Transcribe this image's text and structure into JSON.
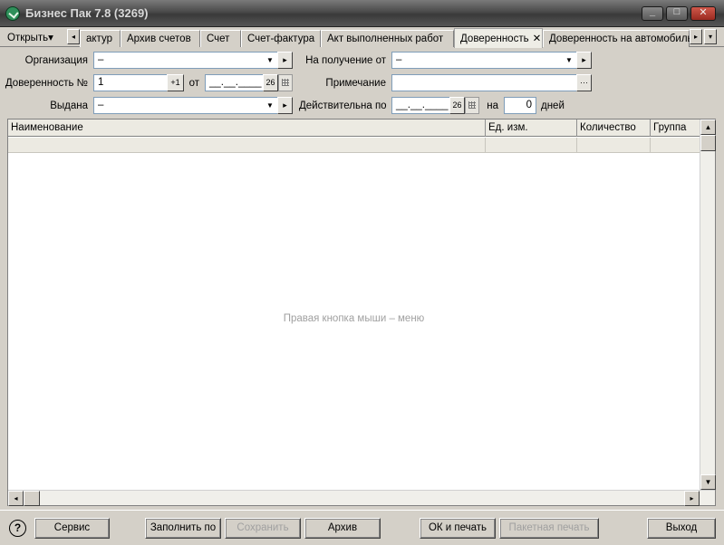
{
  "window": {
    "title": "Бизнес Пак 7.8 (3269)",
    "min_glyph": "_",
    "max_glyph": "□",
    "close_glyph": "✕"
  },
  "tabbar": {
    "open_menu": "Открыть",
    "open_menu_arrow": "▾",
    "prev_arrow": "◂",
    "next_arrow": "▸",
    "overflow_arrow": "▾",
    "tabs": [
      {
        "label": "актур"
      },
      {
        "label": "Архив счетов"
      },
      {
        "label": "Счет"
      },
      {
        "label": "Счет-фактура"
      },
      {
        "label": "Акт выполненных работ"
      },
      {
        "label": "Доверенность",
        "active": true
      },
      {
        "label": "Доверенность на автомобиль"
      }
    ],
    "close_glyph": "✕"
  },
  "form": {
    "org_label": "Организация",
    "org_value": "–",
    "receive_label": "На получение от",
    "receive_value": "–",
    "poa_label": "Доверенность №",
    "poa_number": "1",
    "increment_label": "+1",
    "from_label": "от",
    "date_placeholder": "__.__.____",
    "cal_day": "26",
    "note_label": "Примечание",
    "note_value": "",
    "ellipsis": "···",
    "issued_label": "Выдана",
    "issued_value": "–",
    "valid_label": "Действительна по",
    "valid_date": "__.__.____",
    "on_label": "на",
    "days_value": "0",
    "days_label": "дней",
    "dropdown_glyph": "▼",
    "go_glyph": "▸"
  },
  "grid": {
    "columns": [
      "Наименование",
      "Ед. изм.",
      "Количество",
      "Группа"
    ],
    "empty_hint": "Правая кнопка мыши – меню",
    "up": "▲",
    "down": "▼",
    "left": "◂",
    "right": "▸"
  },
  "footer": {
    "help": "?",
    "service": "Сервис",
    "fill_by": "Заполнить по",
    "save": "Сохранить",
    "archive": "Архив",
    "ok_print": "ОК и печать",
    "batch_print": "Пакетная печать",
    "exit": "Выход"
  }
}
